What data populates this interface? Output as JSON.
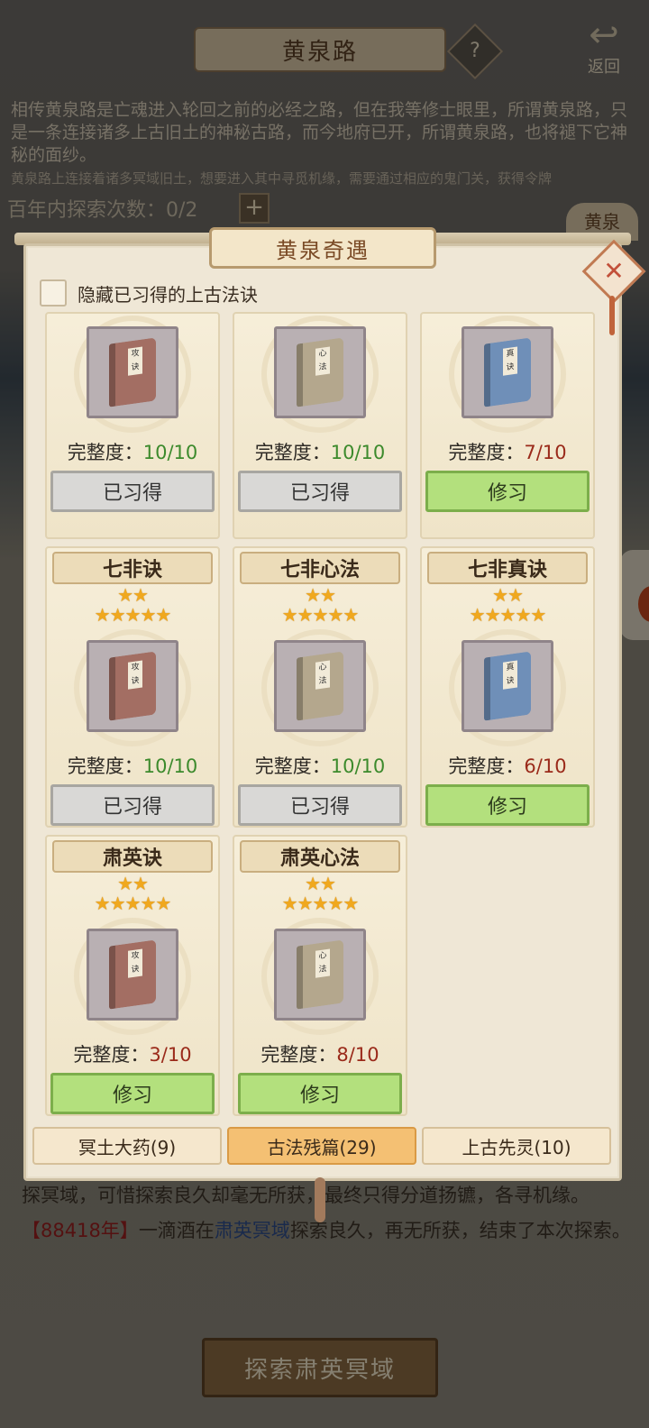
{
  "header": {
    "title": "黄泉路",
    "help_label": "?",
    "back_label": "返回"
  },
  "intro": {
    "text": "相传黄泉路是亡魂进入轮回之前的必经之路，但在我等修士眼里，所谓黄泉路，只是一条连接诸多上古旧土的神秘古路，而今地府已开，所谓黄泉路，也将褪下它神秘的面纱。",
    "note": "黄泉路上连接着诸多冥域旧土，想要进入其中寻觅机缘，需要通过相应的鬼门关，获得令牌"
  },
  "explore": {
    "count_label": "百年内探索次数：0/2",
    "plus_label": "+",
    "region_tag": "黄泉"
  },
  "modal": {
    "title": "黄泉奇遇",
    "close_label": "✕",
    "hide_label": "隐藏已习得的上古法诀",
    "cards": [
      {
        "name": "",
        "grade": "",
        "stars": "★★★★★",
        "book": "red",
        "book_tag": "攻诀",
        "progress_label": "完整度：",
        "progress": "10/10",
        "complete": true,
        "button": "已习得"
      },
      {
        "name": "",
        "grade": "",
        "stars": "★★★★★",
        "book": "tan",
        "book_tag": "心法",
        "progress_label": "完整度：",
        "progress": "10/10",
        "complete": true,
        "button": "已习得"
      },
      {
        "name": "",
        "grade": "",
        "stars": "★★★★★",
        "book": "blue",
        "book_tag": "真诀",
        "progress_label": "完整度：",
        "progress": "7/10",
        "complete": false,
        "button": "修习"
      },
      {
        "name": "七非诀",
        "grade": "★★",
        "stars": "★★★★★",
        "book": "red",
        "book_tag": "攻诀",
        "progress_label": "完整度：",
        "progress": "10/10",
        "complete": true,
        "button": "已习得"
      },
      {
        "name": "七非心法",
        "grade": "★★",
        "stars": "★★★★★",
        "book": "tan",
        "book_tag": "心法",
        "progress_label": "完整度：",
        "progress": "10/10",
        "complete": true,
        "button": "已习得"
      },
      {
        "name": "七非真诀",
        "grade": "★★",
        "stars": "★★★★★",
        "book": "blue",
        "book_tag": "真诀",
        "progress_label": "完整度：",
        "progress": "6/10",
        "complete": false,
        "button": "修习"
      },
      {
        "name": "肃英诀",
        "grade": "★★",
        "stars": "★★★★★",
        "book": "red",
        "book_tag": "攻诀",
        "progress_label": "完整度：",
        "progress": "3/10",
        "complete": false,
        "button": "修习"
      },
      {
        "name": "肃英心法",
        "grade": "★★",
        "stars": "★★★★★",
        "book": "tan",
        "book_tag": "心法",
        "progress_label": "完整度：",
        "progress": "8/10",
        "complete": false,
        "button": "修习"
      }
    ],
    "tabs": [
      {
        "label": "冥土大药(9)",
        "active": false
      },
      {
        "label": "古法残篇(29)",
        "active": true
      },
      {
        "label": "上古先灵(10)",
        "active": false
      }
    ]
  },
  "log": {
    "line1": "探冥域，可惜探索良久却毫无所获，最终只得分道扬镳，各寻机缘。",
    "year": "【88418年】",
    "actor": "一滴酒在",
    "place": "肃英冥域",
    "rest": "探索良久，再无所获，结束了本次探索。"
  },
  "explore_button": "探索肃英冥域",
  "colors": {
    "learn_green": "#b3e07d",
    "learned_gray": "#d9d8d6",
    "star_gold": "#f0a81e",
    "active_tab": "#f4c073"
  }
}
